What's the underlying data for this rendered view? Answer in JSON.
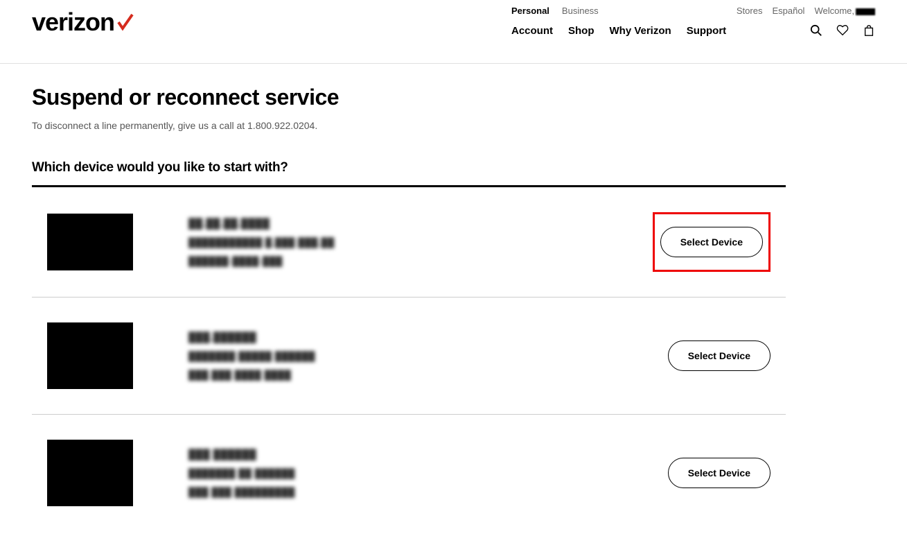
{
  "brand": "verizon",
  "header": {
    "segment_tabs": {
      "personal": "Personal",
      "business": "Business"
    },
    "utility_links": {
      "stores": "Stores",
      "espanol": "Español",
      "welcome_prefix": "Welcome,"
    },
    "main_nav": {
      "account": "Account",
      "shop": "Shop",
      "why": "Why Verizon",
      "support": "Support"
    }
  },
  "page": {
    "title": "Suspend or reconnect service",
    "subtitle": "To disconnect a line permanently, give us a call at 1.800.922.0204.",
    "section_header": "Which device would you like to start with?"
  },
  "devices": [
    {
      "line1": "██.██.██.████",
      "line2": "███████████ █,███ ███,██",
      "line3": "██████-████-███",
      "button": "Select Device",
      "highlighted": true
    },
    {
      "line1": "███.██████",
      "line2": "███████ █████ ██████",
      "line3": "███.███ ████ ████",
      "button": "Select Device",
      "highlighted": false
    },
    {
      "line1": "███ ██████",
      "line2": "███████ ██ ██████",
      "line3": "███ ███ █████████",
      "button": "Select Device",
      "highlighted": false
    }
  ]
}
